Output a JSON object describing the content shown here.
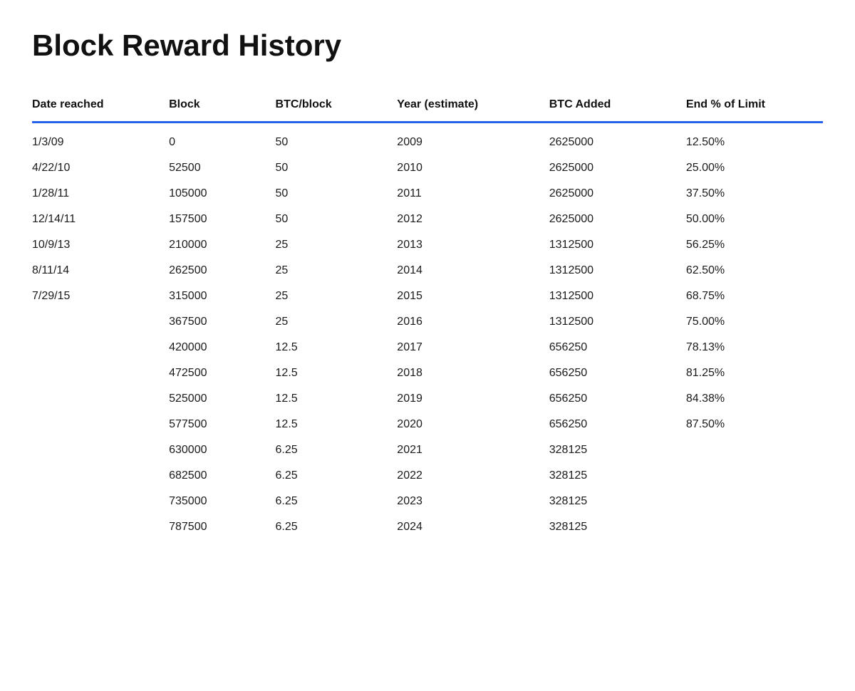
{
  "page": {
    "title": "Block Reward History"
  },
  "table": {
    "headers": [
      "Date reached",
      "Block",
      "BTC/block",
      "Year (estimate)",
      "BTC Added",
      "End % of Limit"
    ],
    "rows": [
      {
        "date": "1/3/09",
        "block": "0",
        "btc_block": "50",
        "year": "2009",
        "btc_added": "2625000",
        "end_pct": "12.50%"
      },
      {
        "date": "4/22/10",
        "block": "52500",
        "btc_block": "50",
        "year": "2010",
        "btc_added": "2625000",
        "end_pct": "25.00%"
      },
      {
        "date": "1/28/11",
        "block": "105000",
        "btc_block": "50",
        "year": "2011",
        "btc_added": "2625000",
        "end_pct": "37.50%"
      },
      {
        "date": "12/14/11",
        "block": "157500",
        "btc_block": "50",
        "year": "2012",
        "btc_added": "2625000",
        "end_pct": "50.00%"
      },
      {
        "date": "10/9/13",
        "block": "210000",
        "btc_block": "25",
        "year": "2013",
        "btc_added": "1312500",
        "end_pct": "56.25%"
      },
      {
        "date": "8/11/14",
        "block": "262500",
        "btc_block": "25",
        "year": "2014",
        "btc_added": "1312500",
        "end_pct": "62.50%"
      },
      {
        "date": "7/29/15",
        "block": "315000",
        "btc_block": "25",
        "year": "2015",
        "btc_added": "1312500",
        "end_pct": "68.75%"
      },
      {
        "date": "",
        "block": "367500",
        "btc_block": "25",
        "year": "2016",
        "btc_added": "1312500",
        "end_pct": "75.00%"
      },
      {
        "date": "",
        "block": "420000",
        "btc_block": "12.5",
        "year": "2017",
        "btc_added": "656250",
        "end_pct": "78.13%"
      },
      {
        "date": "",
        "block": "472500",
        "btc_block": "12.5",
        "year": "2018",
        "btc_added": "656250",
        "end_pct": "81.25%"
      },
      {
        "date": "",
        "block": "525000",
        "btc_block": "12.5",
        "year": "2019",
        "btc_added": "656250",
        "end_pct": "84.38%"
      },
      {
        "date": "",
        "block": "577500",
        "btc_block": "12.5",
        "year": "2020",
        "btc_added": "656250",
        "end_pct": "87.50%"
      },
      {
        "date": "",
        "block": "630000",
        "btc_block": "6.25",
        "year": "2021",
        "btc_added": "328125",
        "end_pct": ""
      },
      {
        "date": "",
        "block": "682500",
        "btc_block": "6.25",
        "year": "2022",
        "btc_added": "328125",
        "end_pct": ""
      },
      {
        "date": "",
        "block": "735000",
        "btc_block": "6.25",
        "year": "2023",
        "btc_added": "328125",
        "end_pct": ""
      },
      {
        "date": "",
        "block": "787500",
        "btc_block": "6.25",
        "year": "2024",
        "btc_added": "328125",
        "end_pct": ""
      }
    ]
  }
}
